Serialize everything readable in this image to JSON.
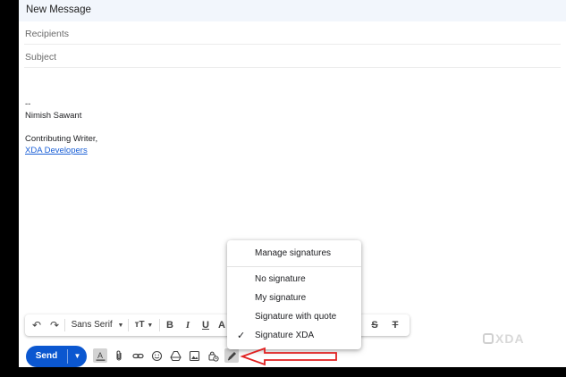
{
  "window": {
    "title": "New Message"
  },
  "fields": {
    "recipients_placeholder": "Recipients",
    "subject_placeholder": "Subject"
  },
  "body": {
    "sig_delim": "--",
    "name": "Nimish Sawant",
    "role": "Contributing Writer,",
    "company_link": "XDA Developers"
  },
  "signature_menu": {
    "manage": "Manage signatures",
    "items": [
      "No signature",
      "My signature",
      "Signature with quote",
      "Signature XDA"
    ],
    "selected": "Signature XDA"
  },
  "format_bar": {
    "font": "Sans Serif",
    "undo_icon": "↶",
    "redo_icon": "↷",
    "size_icon": "тT",
    "bold": "B",
    "italic": "I",
    "underline": "U",
    "text_color": "A",
    "strike": "S",
    "clear_format": "T"
  },
  "send": {
    "label": "Send"
  },
  "watermark": "XDA",
  "colors": {
    "send_blue": "#0b57d0",
    "link_blue": "#1a5fd6",
    "arrow_red": "#e02020"
  },
  "icons": [
    "text-format-icon",
    "attach-icon",
    "link-icon",
    "emoji-icon",
    "drive-icon",
    "photo-icon",
    "lock-clock-icon",
    "pen-icon"
  ]
}
